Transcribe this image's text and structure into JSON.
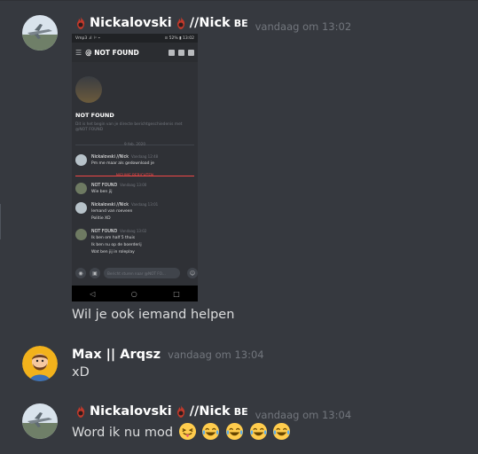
{
  "messages": [
    {
      "author": "Nickalovski",
      "author_suffix": "//Nick",
      "flag": "BE",
      "timestamp": "vandaag om 13:02",
      "text": "Wil je ook iemand helpen",
      "attachment": {
        "status_left": "Vmp3 .ıl ⚐ ⌁",
        "status_right": "⊙ 52% ▮ 13:02",
        "channel": "@ NOT FOUND",
        "profile_name": "NOT FOUND",
        "profile_sub": "Dit is het begin van je directe berichtgeschiedenis met @NOT FOUND",
        "date_sep": "9 feb. 2020",
        "new_sep": "NIEUWE BERICHTEN",
        "chat": [
          {
            "name": "Nickalovski //Nick",
            "ts": "Vandaag 12:48",
            "lines": [
              "Pm me maar als gedownload je"
            ]
          },
          {
            "name": "NOT FOUND",
            "ts": "Vandaag 13:00",
            "lines": [
              "Wie ben jij"
            ]
          },
          {
            "name": "Nickalovski //Nick",
            "ts": "Vandaag 13:01",
            "lines": [
              "Iemand van roeveen",
              "Politie XD"
            ]
          },
          {
            "name": "NOT FOUND",
            "ts": "Vandaag 13:02",
            "lines": [
              "Ik ben om half 5 thuis",
              "Ik ben nu op de boerderij",
              "Wat ben jij in roleplay"
            ]
          }
        ],
        "input_placeholder": "Bericht sturen naar @NOT FO..."
      }
    },
    {
      "author": "Max || Arqsz",
      "timestamp": "vandaag om 13:04",
      "text": "xD"
    },
    {
      "author": "Nickalovski",
      "author_suffix": "//Nick",
      "flag": "BE",
      "timestamp": "vandaag om 13:04",
      "text": "Word ik nu mod",
      "emojis": [
        "tongue-out-emoji",
        "laughing-emoji",
        "laughing-emoji",
        "laughing-emoji",
        "laughing-emoji"
      ]
    }
  ],
  "colors": {
    "background": "#36393f",
    "username": "#ffffff",
    "timestamp": "#72767d",
    "text": "#dcddde",
    "flame": "#c0392b"
  }
}
